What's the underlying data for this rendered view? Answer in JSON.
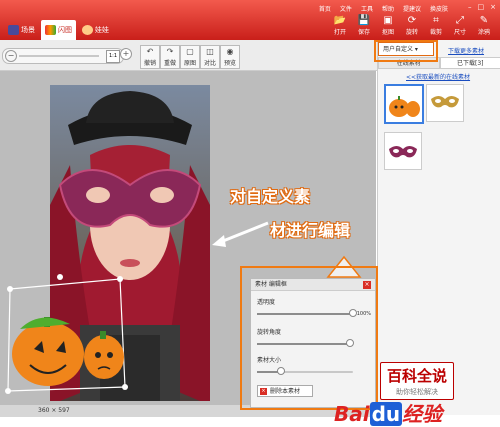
{
  "top_menu": [
    "首页",
    "文件",
    "工具",
    "帮助",
    "提建议",
    "换皮肤"
  ],
  "tabs": [
    {
      "label": "场景",
      "active": false
    },
    {
      "label": "闪图",
      "active": true
    },
    {
      "label": "娃娃",
      "active": false
    }
  ],
  "toolbar": [
    {
      "icon": "open-icon",
      "label": "打开"
    },
    {
      "icon": "save-icon",
      "label": "保存"
    },
    {
      "icon": "screenshot-icon",
      "label": "抠图"
    },
    {
      "icon": "rotate-icon",
      "label": "旋转"
    },
    {
      "icon": "crop-icon",
      "label": "裁剪"
    },
    {
      "icon": "size-icon",
      "label": "尺寸"
    },
    {
      "icon": "redo-icon",
      "label": "涂鸦"
    }
  ],
  "edit_buttons": [
    {
      "icon": "undo-icon",
      "label": "撤销"
    },
    {
      "icon": "redo-icon",
      "label": "重做"
    },
    {
      "icon": "original-icon",
      "label": "原图"
    },
    {
      "icon": "compare-icon",
      "label": "对比"
    },
    {
      "icon": "preview-icon",
      "label": "预览"
    }
  ],
  "zoom_fit_label": "1:1",
  "statusbar": {
    "size": "360 × 597"
  },
  "right_panel": {
    "user_select": "用户自定义",
    "download_more": "下载更多素材",
    "subtabs": [
      "在线素材",
      "已下载[3]"
    ],
    "get_new": "<<获取最新的在线素材"
  },
  "edit_dialog": {
    "title": "素材 编辑框",
    "opacity_label": "透明度",
    "opacity_value": "100%",
    "opacity": 1.0,
    "rotate_label": "旋转角度",
    "rotate": 0.97,
    "size_label": "素材大小",
    "size": 0.25,
    "delete_label": "删除本素材"
  },
  "annotation": {
    "line1": "对自定义素",
    "line2": "材进行编辑"
  },
  "watermark": {
    "title": "百科全说",
    "subtitle": "助你轻松解决",
    "brand_bai": "Bai",
    "brand_du": "du",
    "brand_jingyan": "经验"
  },
  "colors": {
    "accent": "#e5231b",
    "highlight": "#f07a12",
    "link": "#1a4dbf"
  }
}
